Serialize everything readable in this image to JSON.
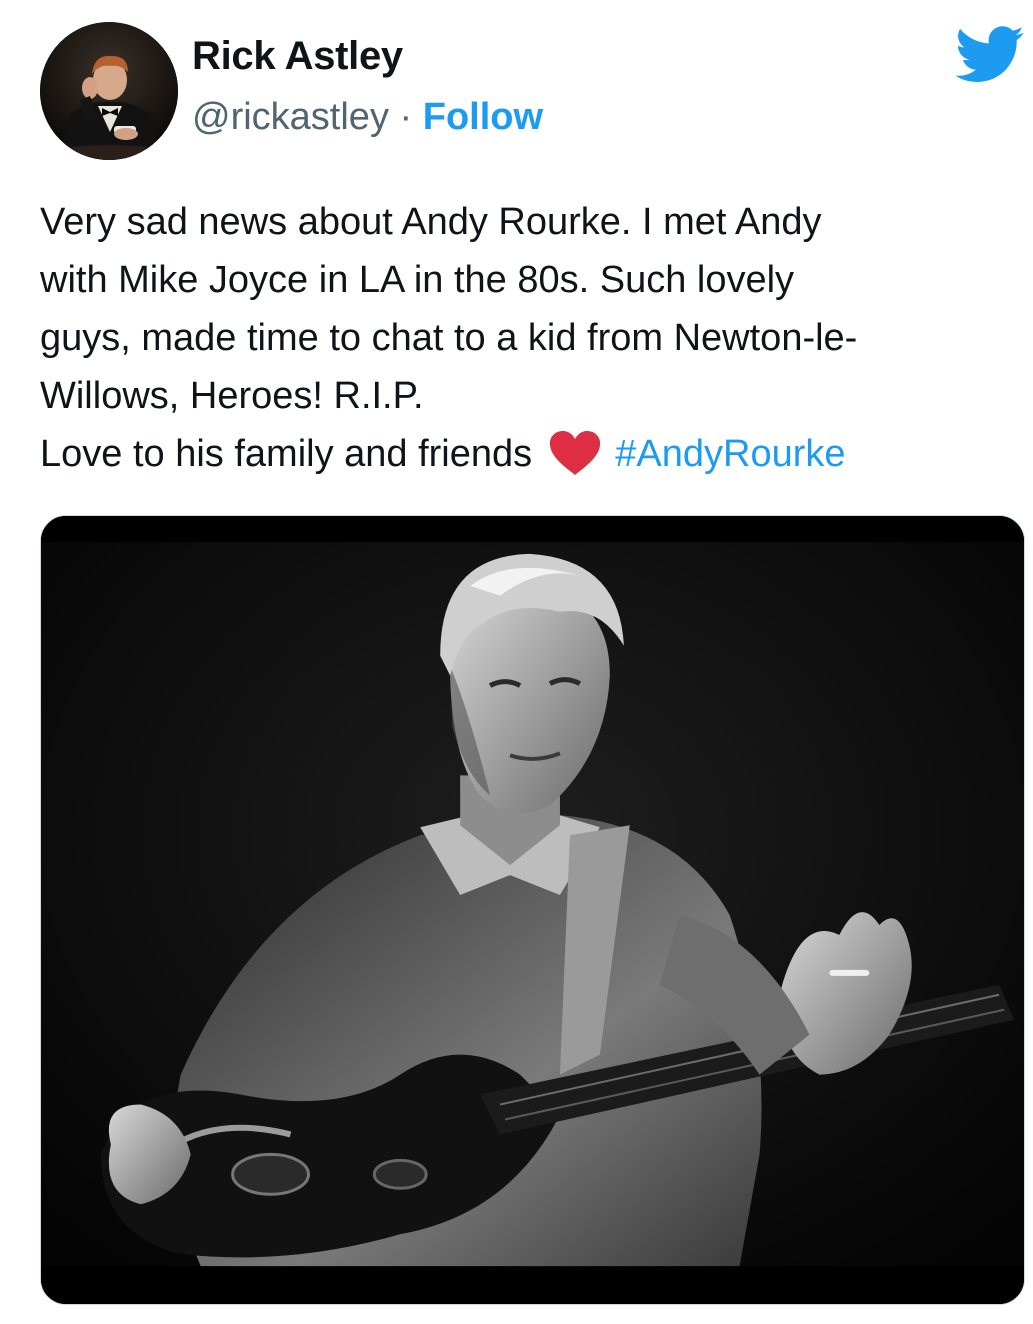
{
  "author": {
    "display_name": "Rick Astley",
    "handle": "@rickastley",
    "separator": " · ",
    "follow_label": "Follow"
  },
  "tweet": {
    "lines": [
      "Very sad news about Andy Rourke. I met Andy",
      "with Mike Joyce in LA in the 80s. Such lovely",
      "guys, made time to chat to a kid from Newton-le-",
      "Willows, Heroes! R.I.P."
    ],
    "last_line_text": "Love to his family and friends",
    "hashtag": "#AndyRourke"
  },
  "icons": {
    "avatar": "profile-photo",
    "brand": "twitter-bird-icon",
    "emoji": "red-heart-emoji"
  },
  "colors": {
    "link": "#1d9bf0",
    "handle": "#536471",
    "text": "#0f1419",
    "heart": "#dd2e44"
  },
  "media": {
    "kind": "black-and-white photo of a bassist playing a bass guitar"
  }
}
